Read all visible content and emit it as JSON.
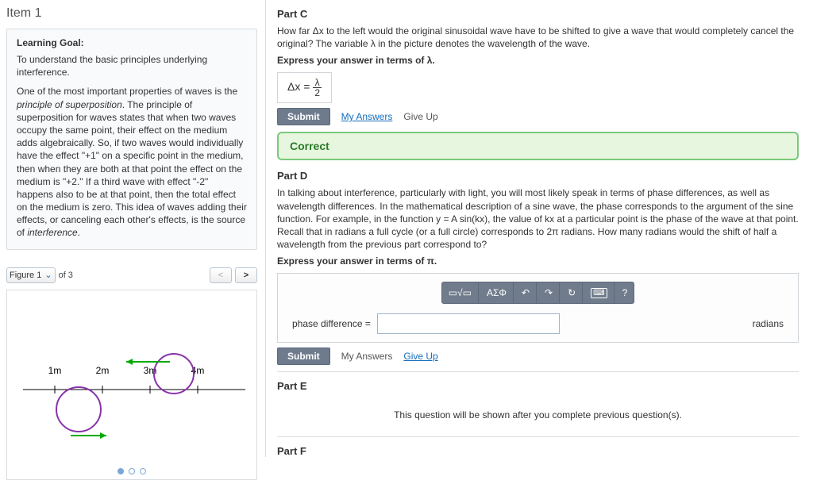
{
  "left": {
    "item_title": "Item 1",
    "lg_head": "Learning Goal:",
    "lg_text": "To understand the basic principles underlying interference.",
    "lg_para": "One of the most important properties of waves is the principle of superposition. The principle of superposition for waves states that when two waves occupy the same point, their effect on the medium adds algebraically. So, if two waves would individually have the effect \"+1\" on a specific point in the medium, then when they are both at that point the effect on the medium is \"+2.\" If a third wave with effect \"-2\" happens also to be at that point, then the total effect on the medium is zero. This idea of waves adding their effects, or canceling each other's effects, is the source of interference.",
    "figure": {
      "label": "Figure 1",
      "of_text": "of 3",
      "prev": "<",
      "next": ">",
      "ticks": [
        "1m",
        "2m",
        "3m",
        "4m"
      ]
    }
  },
  "partC": {
    "head": "Part C",
    "q": "How far Δx to the left would the original sinusoidal wave have to be shifted to give a wave that would completely cancel the original? The variable λ in the picture denotes the wavelength of the wave.",
    "express": "Express your answer in terms of λ.",
    "ans_label": "Δx = ",
    "ans_num": "λ",
    "ans_den": "2",
    "submit": "Submit",
    "my_answers": "My Answers",
    "give_up": "Give Up",
    "correct": "Correct"
  },
  "partD": {
    "head": "Part D",
    "q": "In talking about interference, particularly with light, you will most likely speak in terms of phase differences, as well as wavelength differences. In the mathematical description of a sine wave, the phase corresponds to the argument of the sine function. For example, in the function y = A sin(kx), the value of kx at a particular point is the phase of the wave at that point. Recall that in radians a full cycle (or a full circle) corresponds to 2π radians. How many radians would the shift of half a wavelength from the previous part correspond to?",
    "express": "Express your answer in terms of π.",
    "toolbar": {
      "templates": "▭√▭",
      "greek": "ΑΣΦ",
      "undo": "↶",
      "redo": "↷",
      "reset": "↻",
      "keyboard": "⌨",
      "help": "?"
    },
    "phase_label": "phase difference =",
    "units": "radians",
    "submit": "Submit",
    "my_answers": "My Answers",
    "give_up": "Give Up"
  },
  "partE": {
    "head": "Part E",
    "msg": "This question will be shown after you complete previous question(s)."
  },
  "partF": {
    "head": "Part F"
  }
}
